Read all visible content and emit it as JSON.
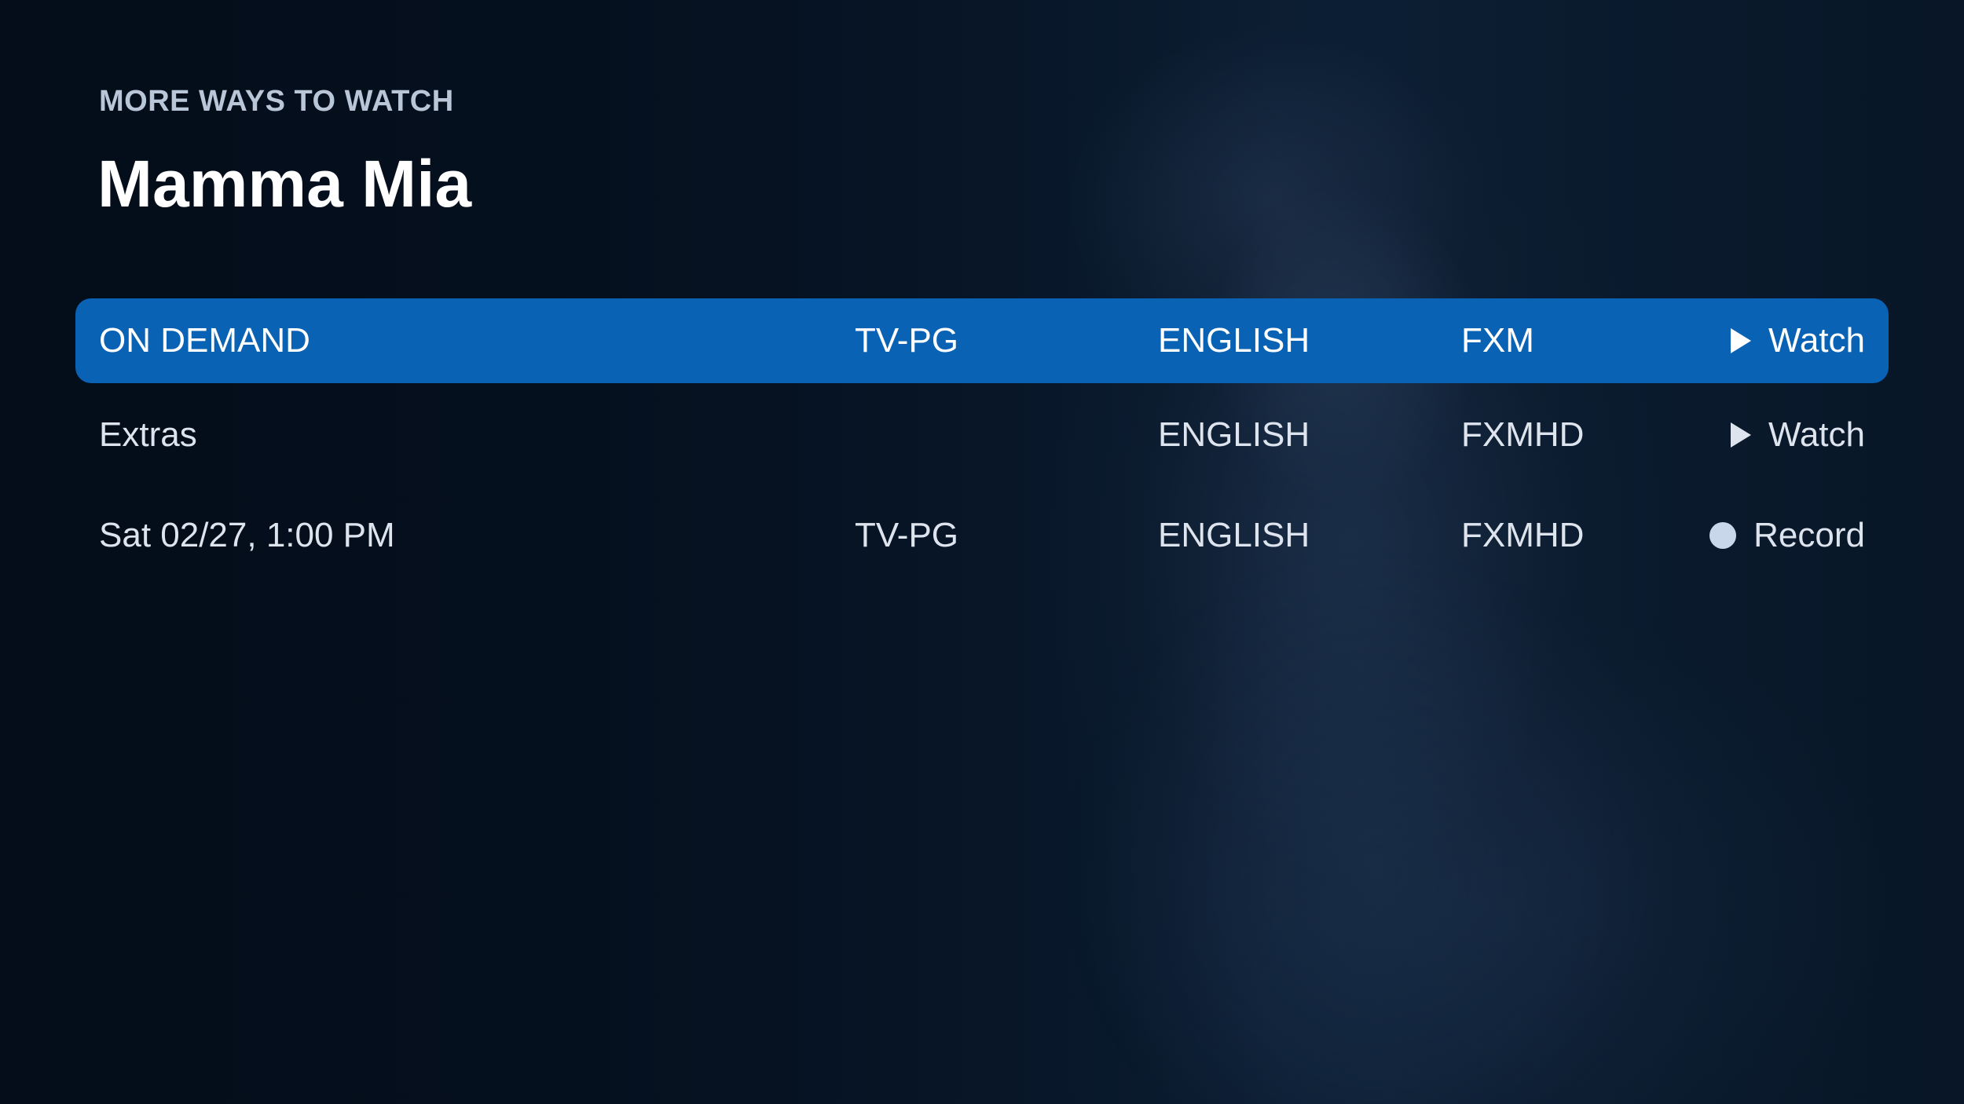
{
  "header": {
    "eyebrow": "MORE WAYS TO WATCH",
    "title": "Mamma Mia"
  },
  "colors": {
    "selected_row": "#0a62b4",
    "background": "#081525",
    "record_dot": "#c9d7ea"
  },
  "rows": [
    {
      "type": "ON DEMAND",
      "rating": "TV-PG",
      "language": "ENGLISH",
      "channel": "FXM",
      "action_label": "Watch",
      "action_icon": "play-icon",
      "selected": true
    },
    {
      "type": "Extras",
      "rating": "",
      "language": "ENGLISH",
      "channel": "FXMHD",
      "action_label": "Watch",
      "action_icon": "play-icon",
      "selected": false
    },
    {
      "type": "Sat 02/27, 1:00 PM",
      "rating": "TV-PG",
      "language": "ENGLISH",
      "channel": "FXMHD",
      "action_label": "Record",
      "action_icon": "record-icon",
      "selected": false
    }
  ]
}
